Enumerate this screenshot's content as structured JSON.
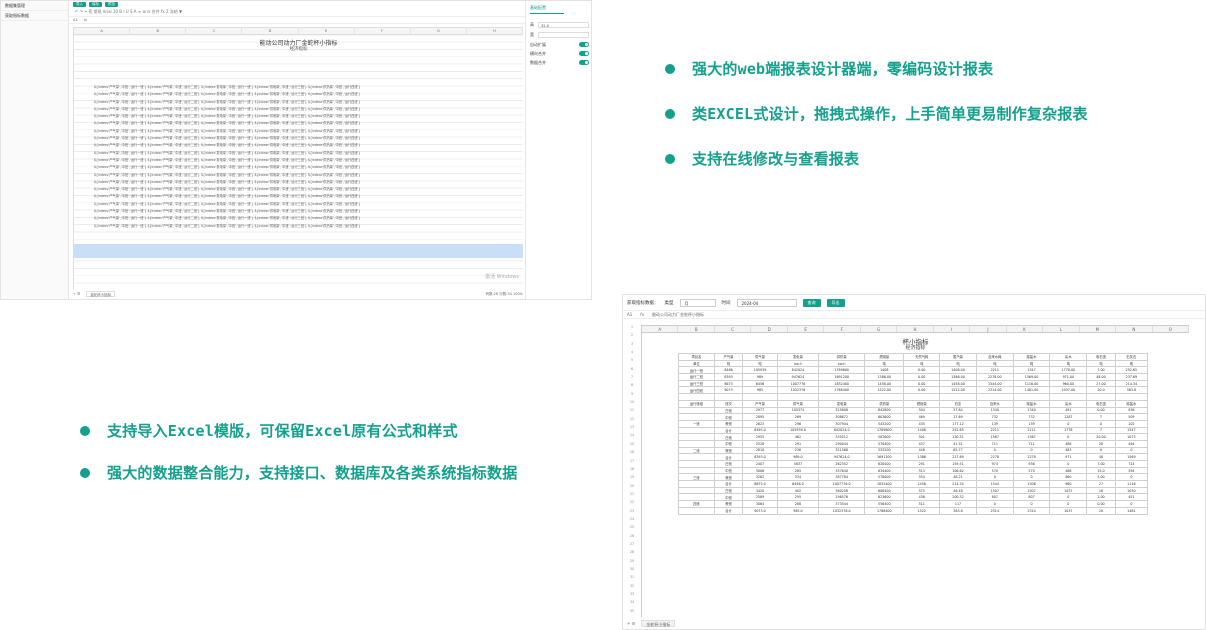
{
  "features_right": [
    "强大的web端报表设计器端，零编码设计报表",
    "类EXCEL式设计，拖拽式操作，上手简单更易制作复杂报表",
    "支持在线修改与查看报表"
  ],
  "features_left": [
    "支持导入Excel模版，可保留Excel原有公式和样式",
    "强大的数据整合能力，支持接口、数据库及各类系统指标数据"
  ],
  "colors": {
    "accent": "#13a08c",
    "highlight_row": "#c9dff7"
  },
  "designer": {
    "sidebar": [
      "数据集管理",
      "获取指标数据"
    ],
    "top_buttons": [
      "导入",
      "保存",
      "预览"
    ],
    "toolbar": "↶ ↷ ✂ ⎘ 常规 Arial 10 B I U S A ≡ ⊞ ⊟ 合并 fx Σ 冻结 ▼",
    "cell_ref": "A1",
    "col_headers": [
      "A",
      "B",
      "C",
      "D",
      "E",
      "F",
      "G",
      "H"
    ],
    "report_title": "能动公司动力厂金蛇杯小指标",
    "report_subtitle": "经济指标",
    "sheet_tab": "金蛇杯小指标",
    "status": "列数:26  行数:34  100%",
    "watermark": "激活 Windows",
    "panel": {
      "title": "基础配置",
      "height_label": "高",
      "height_value": "32.0",
      "width_label": "宽",
      "switches": [
        "自动扩展",
        "横向合并",
        "数据合并"
      ]
    },
    "fill_text": "${indexc'产气量','中班','运行一班'}  ${indexc'产气量','中班','运行二班'}  ${indexc'发电量','中班','运行一班'}  ${indexc'供电量','中班','运行三班'}  ${indexc'供热量','中班','运行四班'}"
  },
  "viewer": {
    "filters": {
      "label": "获取指标数据：",
      "type_label": "类型",
      "type_value": "月",
      "time_label": "时间",
      "time_value": "2024-04",
      "query_button": "查询",
      "export_button": "导出"
    },
    "cell_ref": "A1",
    "formula_text": "能动公司动力厂金蛇杯小指标",
    "col_headers": [
      "A",
      "B",
      "C",
      "D",
      "E",
      "F",
      "G",
      "H",
      "I",
      "J",
      "K",
      "L",
      "M",
      "N",
      "O"
    ],
    "report_title": "杯小指标",
    "report_subtitle": "经济指标",
    "table_headers": [
      "项目名",
      "产气量",
      "供气量",
      "发电量",
      "供热量",
      "燃烧量",
      "天然气耗",
      "蒸汽量",
      "自来水耗",
      "除盐水",
      "氟水",
      "电石渣",
      "石灰石"
    ],
    "table_units": [
      "单位",
      "吨",
      "吨",
      "kw.h",
      "kw.h",
      "吨",
      "吨",
      "吨",
      "吨",
      "吨",
      "吨",
      "吨",
      "吨"
    ],
    "table_rows": [
      [
        "运行一班",
        "8466",
        "105939",
        "842024",
        "1789600",
        "1408",
        "0.00",
        "1408.00",
        "2211",
        "1547",
        "1778.00",
        "7.00",
        "252.65"
      ],
      [
        "运行二班",
        "8393",
        "989",
        "947624",
        "1691200",
        "1386.00",
        "0.00",
        "1386.00",
        "2278.00",
        "1569.00",
        "971.00",
        "48.00",
        "237.69"
      ],
      [
        "运行三班",
        "8675",
        "6456",
        "1007776",
        "1832400",
        "1458.00",
        "0.00",
        "1458.00",
        "1544.00",
        "1116.00",
        "960.00",
        "27.00",
        "214.34"
      ],
      [
        "运行四班",
        "9073",
        "985",
        "1032376",
        "1768400",
        "1522.00",
        "0.00",
        "1522.00",
        "2314.00",
        "1481.00",
        "1037.00",
        "20.0",
        "363.8"
      ],
      [
        "",
        "",
        "",
        "",
        "",
        "",
        "",
        "",
        "",
        "",
        "",
        "",
        ""
      ],
      [
        "运行班组",
        "班次",
        "产气量",
        "供气量",
        "发电量",
        "供热量",
        "燃烧量",
        "石灰",
        "自来水",
        "除盐水",
        "氟水",
        "电石渣",
        "除盐水"
      ],
      [
        "",
        "白班",
        "2977",
        "105374",
        "325808",
        "842800",
        "504",
        "57.84",
        "1340",
        "1340",
        "491",
        "0.00",
        "936"
      ],
      [
        "",
        "中班",
        "2895",
        "269",
        "308672",
        "603600",
        "469",
        "17.69",
        "732",
        "732",
        "1287",
        "7",
        "509"
      ],
      [
        "一班",
        "夜班",
        "2623",
        "296",
        "307944",
        "543200",
        "435",
        "177.12",
        "139",
        "139",
        "0",
        "0",
        "102"
      ],
      [
        "",
        "合计",
        "8495.0",
        "105939.0",
        "842024.0",
        "1789600",
        "1408",
        "252.65",
        "2211",
        "2211",
        "1778",
        "7",
        "1547"
      ],
      [
        "",
        "白班",
        "2955",
        "462",
        "335512",
        "587600",
        "501",
        "130.51",
        "1567",
        "1567",
        "0",
        "20.00",
        "1075"
      ],
      [
        "",
        "中班",
        "2528",
        "291",
        "290044",
        "570400",
        "437",
        "41.51",
        "711",
        "711",
        "488",
        "28",
        "494"
      ],
      [
        "二班",
        "夜班",
        "2810",
        "236",
        "321568",
        "533200",
        "448",
        "65.77",
        "0",
        "0",
        "483",
        "0",
        "0"
      ],
      [
        "",
        "合计",
        "8393.0",
        "989.0",
        "947624.0",
        "1691200",
        "1386",
        "237.69",
        "2278",
        "2278",
        "971",
        "48",
        "1569"
      ],
      [
        "",
        "白班",
        "2407",
        "5837",
        "262352",
        "620000",
        "291",
        "159.51",
        "974",
        "936",
        "0",
        "7.00",
        "724"
      ],
      [
        "",
        "中班",
        "3006",
        "285",
        "357640",
        "634400",
        "513",
        "106.62",
        "570",
        "570",
        "488",
        "15.0",
        "394"
      ],
      [
        "三班",
        "夜班",
        "3262",
        "334",
        "387784",
        "578000",
        "554",
        "48.21",
        "0",
        "0",
        "960",
        "5.00",
        "0"
      ],
      [
        "",
        "合计",
        "8675.0",
        "6456.0",
        "1007776.0",
        "1832400",
        "1458",
        "214.34",
        "1544",
        "1506",
        "960",
        "27",
        "1116"
      ],
      [
        "",
        "白班",
        "3420",
        "402",
        "360258",
        "608400",
        "575",
        "46.48",
        "1507",
        "1507",
        "1037",
        "18",
        "1030"
      ],
      [
        "",
        "中班",
        "2589",
        "295",
        "298576",
        "623600",
        "436",
        "200.32",
        "807",
        "807",
        "0",
        "2.00",
        "451"
      ],
      [
        "四班",
        "夜班",
        "3064",
        "288",
        "373544",
        "556400",
        "511",
        "117",
        "0",
        "0",
        "0",
        "0.00",
        "0"
      ],
      [
        "",
        "合计",
        "9073.0",
        "985.0",
        "1032376.0",
        "1788400",
        "1522",
        "363.8",
        "2314",
        "2314",
        "1037",
        "20",
        "1481"
      ]
    ],
    "row_numbers": [
      "1",
      "2",
      "3",
      "4",
      "5",
      "6",
      "7",
      "8",
      "9",
      "10",
      "11",
      "12",
      "13",
      "14",
      "15",
      "16",
      "17",
      "18",
      "19",
      "20",
      "21",
      "22",
      "23",
      "24",
      "25",
      "26",
      "27",
      "28",
      "29",
      "30",
      "31",
      "32",
      "33",
      "34",
      "35"
    ],
    "sheet_tab": "金蛇杯小指标"
  }
}
